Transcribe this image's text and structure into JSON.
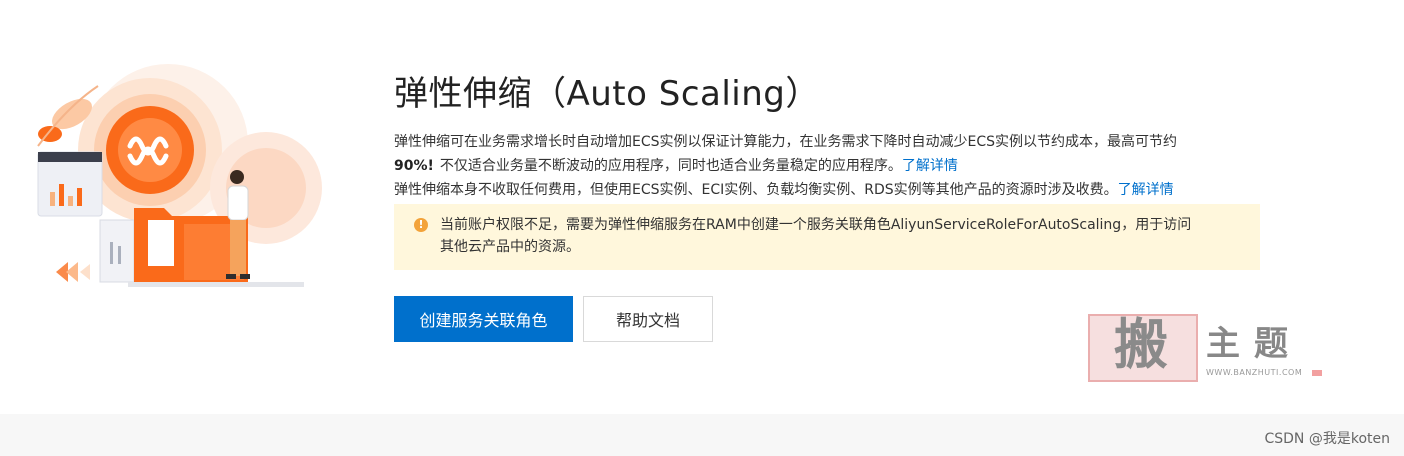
{
  "page": {
    "title": "弹性伸缩（Auto Scaling）",
    "description": {
      "line1_text": "弹性伸缩可在业务需求增长时自动增加ECS实例以保证计算能力，在业务需求下降时自动减少ECS实例以节约成本，最高可节约",
      "line2_bold": "90%!",
      "line2_text": "不仅适合业务量不断波动的应用程序，同时也适合业务量稳定的应用程序。",
      "line2_link": "了解详情",
      "line3_text": "弹性伸缩本身不收取任何费用，但使用ECS实例、ECI实例、负载均衡实例、RDS实例等其他产品的资源时涉及收费。",
      "line3_link": "了解详情"
    },
    "alert": {
      "icon": "!",
      "text_line1": "当前账户权限不足，需要为弹性伸缩服务在RAM中创建一个服务关联角色AliyunServiceRoleForAutoScaling，用于访问",
      "text_line2": "其他云产品中的资源。"
    },
    "buttons": {
      "primary_label": "创建服务关联角色",
      "secondary_label": "帮助文档"
    }
  },
  "watermark": {
    "seal_char": "搬",
    "text": "主题",
    "url": "WWW.BANZHUTI.COM"
  },
  "footer": {
    "credit": "CSDN @我是koten"
  },
  "colors": {
    "primary": "#0070cc",
    "link": "#0070cc",
    "alert_bg": "#fff7dc",
    "alert_icon": "#f3a33a",
    "illustration_orange": "#fa6a1a",
    "footer_bg": "#f7f7f7"
  }
}
